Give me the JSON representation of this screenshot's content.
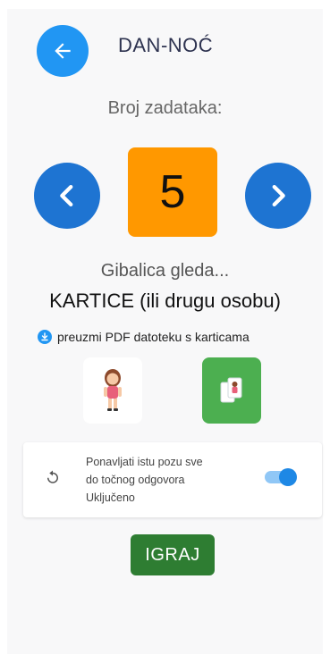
{
  "header": {
    "title": "DAN-NOĆ",
    "back_icon": "arrow-left-icon"
  },
  "task_count": {
    "label": "Broj zadataka:",
    "value": "5",
    "prev_icon": "chevron-left-icon",
    "next_icon": "chevron-right-icon"
  },
  "looks_at": {
    "label": "Gibalica gleda...",
    "selection": "KARTICE (ili drugu osobu)"
  },
  "pdf_link": {
    "text": "preuzmi PDF datoteku s karticama",
    "icon": "download-icon"
  },
  "mode_options": [
    {
      "icon": "girl-icon",
      "selected": false
    },
    {
      "icon": "cards-icon",
      "selected": true
    }
  ],
  "repeat_option": {
    "line1": "Ponavljati istu pozu sve",
    "line2": "do točnog odgovora",
    "status": "Uključeno",
    "icon": "repeat-icon",
    "enabled": true
  },
  "play_button": {
    "label": "IGRAJ"
  },
  "colors": {
    "primary_blue": "#2196f3",
    "nav_blue": "#1e74d2",
    "count_orange": "#ff9800",
    "selected_green": "#4caf50",
    "play_green": "#2e7d32"
  }
}
